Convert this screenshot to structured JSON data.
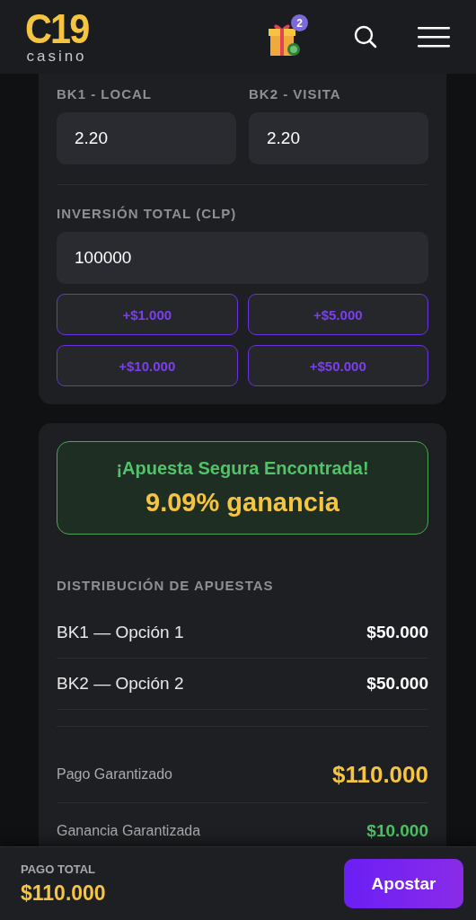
{
  "header": {
    "logo": "C19",
    "logo_sub": "casino",
    "gift_badge": "2"
  },
  "odds": [
    {
      "label": "BK1 - LOCAL",
      "value": "2.20"
    },
    {
      "label": "BK2 - VISITA",
      "value": "2.20"
    }
  ],
  "investment": {
    "label": "INVERSIÓN TOTAL (CLP)",
    "value": "100000"
  },
  "quick_amounts": [
    "+$1.000",
    "+$5.000",
    "+$10.000",
    "+$50.000"
  ],
  "result": {
    "title": "¡Apuesta Segura Encontrada!",
    "profit": "9.09% ganancia"
  },
  "distribution": {
    "title": "DISTRIBUCIÓN DE APUESTAS",
    "rows": [
      {
        "label": "BK1 — Opción 1",
        "value": "$50.000"
      },
      {
        "label": "BK2 — Opción 2",
        "value": "$50.000"
      }
    ]
  },
  "summary": [
    {
      "kind": "payout",
      "label": "Pago Garantizado",
      "value": "$110.000"
    },
    {
      "kind": "profit",
      "label": "Ganancia Garantizada",
      "value": "$10.000"
    }
  ],
  "footer": {
    "label": "PAGO TOTAL",
    "value": "$110.000",
    "button": "Apostar"
  }
}
